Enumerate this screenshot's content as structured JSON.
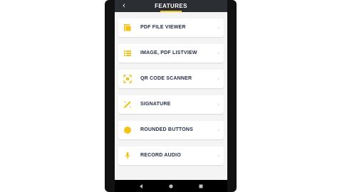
{
  "app_bar": {
    "back_icon": "arrow-left-icon",
    "title": "FEATURES"
  },
  "features": [
    {
      "label": "PDF FILE VIEWER",
      "icon": "pdf-file-icon"
    },
    {
      "label": "IMAGE, PDF LISTVIEW",
      "icon": "list-icon"
    },
    {
      "label": "QR CODE SCANNER",
      "icon": "qr-scan-icon"
    },
    {
      "label": "SIGNATURE",
      "icon": "signature-pen-icon"
    },
    {
      "label": "ROUNDED BUTTONS",
      "icon": "circle-button-icon"
    },
    {
      "label": "RECORD AUDIO",
      "icon": "microphone-icon"
    }
  ],
  "chevron_icon": "chevron-right-icon",
  "nav_bar": {
    "back_icon": "triangle-back-icon",
    "home_icon": "circle-home-icon",
    "recents_icon": "square-recents-icon"
  },
  "colors": {
    "accent": "#f2c21b",
    "app_bar": "#2b2e33",
    "label": "#253049",
    "background": "#f4f4f4"
  }
}
